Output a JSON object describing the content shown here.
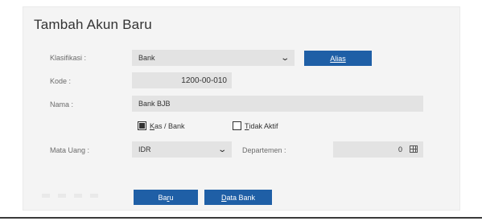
{
  "form": {
    "title": "Tambah Akun Baru",
    "klasifikasi": {
      "label": "Klasifikasi :",
      "value": "Bank"
    },
    "alias_button": "Alias",
    "kode": {
      "label": "Kode :",
      "value": "1200-00-010"
    },
    "nama": {
      "label": "Nama :",
      "value": "Bank BJB"
    },
    "kas_bank": {
      "prefix": "K",
      "rest": "as / Bank",
      "checked": true
    },
    "tidak_aktif": {
      "prefix": "T",
      "rest": "idak Aktif",
      "checked": false
    },
    "mata_uang": {
      "label": "Mata Uang :",
      "value": "IDR"
    },
    "departemen": {
      "label": "Departemen :",
      "value": "0"
    },
    "baru_button": {
      "pre": "Ba",
      "u": "r",
      "post": "u"
    },
    "data_bank_button": {
      "pre": "",
      "u": "D",
      "post": "ata Bank"
    }
  },
  "icons": {
    "dropdown": "chevron-down-icon",
    "lookup": "grid-icon"
  }
}
